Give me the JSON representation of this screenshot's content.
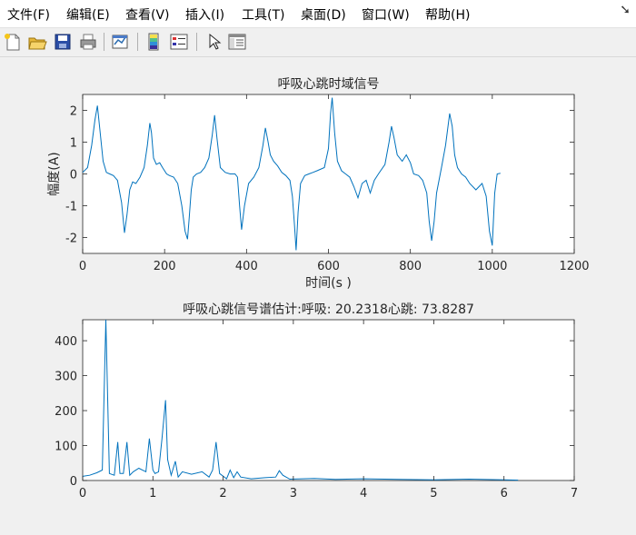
{
  "menubar": {
    "items": [
      "文件(F)",
      "编辑(E)",
      "查看(V)",
      "插入(I)",
      "工具(T)",
      "桌面(D)",
      "窗口(W)",
      "帮助(H)"
    ]
  },
  "toolbar": {
    "icons": [
      "new-figure-icon",
      "open-file-icon",
      "save-icon",
      "print-icon",
      "link-plot-icon",
      "insert-colorbar-icon",
      "insert-legend-icon",
      "edit-plot-icon",
      "property-inspector-icon"
    ]
  },
  "plot1": {
    "title": "呼吸心跳时域信号",
    "xlabel": "时间(s )",
    "ylabel": "幅度(A)",
    "xticks": [
      "0",
      "200",
      "400",
      "600",
      "800",
      "1000",
      "1200"
    ],
    "yticks": [
      "2",
      "1",
      "0",
      "-1",
      "-2"
    ]
  },
  "plot2": {
    "title": "呼吸心跳信号谱估计:呼吸: 20.2318心跳: 73.8287",
    "xticks": [
      "0",
      "1",
      "2",
      "3",
      "4",
      "5",
      "6",
      "7"
    ],
    "yticks": [
      "400",
      "300",
      "200",
      "100",
      "0"
    ]
  },
  "colors": {
    "line": "#0072bd",
    "axes": "#262626",
    "menubar": "#ffffff",
    "window": "#f0f0f0"
  },
  "chart_data": [
    {
      "type": "line",
      "title": "呼吸心跳时域信号",
      "xlabel": "时间(s )",
      "ylabel": "幅度(A)",
      "xlim": [
        0,
        1200
      ],
      "ylim": [
        -2.5,
        2.5
      ],
      "grid": false,
      "series": [
        {
          "x": [
            0,
            12,
            22,
            30,
            36,
            42,
            50,
            58,
            66,
            75,
            85,
            95,
            102,
            108,
            115,
            122,
            130,
            140,
            150,
            158,
            164,
            168,
            173,
            180,
            188,
            195,
            205,
            212,
            222,
            232,
            242,
            250,
            256,
            260,
            265,
            270,
            278,
            288,
            298,
            308,
            316,
            322,
            328,
            336,
            348,
            360,
            372,
            378,
            383,
            388,
            395,
            405,
            418,
            430,
            440,
            446,
            452,
            458,
            466,
            476,
            486,
            496,
            506,
            512,
            517,
            521,
            526,
            532,
            542,
            552,
            562,
            572,
            590,
            600,
            605,
            609,
            615,
            622,
            632,
            642,
            652,
            662,
            672,
            682,
            692,
            702,
            712,
            722,
            738,
            748,
            754,
            760,
            768,
            780,
            790,
            800,
            808,
            820,
            830,
            840,
            846,
            852,
            858,
            864,
            870,
            876,
            886,
            896,
            902,
            908,
            915,
            925,
            935,
            945,
            960,
            975,
            985,
            993,
            1000,
            1006,
            1012,
            1020
          ],
          "y": [
            0.05,
            0.2,
            0.9,
            1.7,
            2.15,
            1.4,
            0.4,
            0.05,
            0.0,
            -0.05,
            -0.2,
            -0.9,
            -1.85,
            -1.3,
            -0.5,
            -0.25,
            -0.3,
            -0.1,
            0.2,
            0.9,
            1.6,
            1.3,
            0.5,
            0.3,
            0.35,
            0.2,
            0.0,
            -0.05,
            -0.1,
            -0.3,
            -1.0,
            -1.8,
            -2.05,
            -1.4,
            -0.5,
            -0.1,
            0.0,
            0.05,
            0.2,
            0.5,
            1.2,
            1.85,
            1.1,
            0.2,
            0.05,
            0.0,
            0.0,
            -0.1,
            -1.0,
            -1.75,
            -1.0,
            -0.3,
            -0.1,
            0.2,
            0.9,
            1.45,
            1.05,
            0.6,
            0.4,
            0.25,
            0.05,
            -0.05,
            -0.2,
            -0.7,
            -1.6,
            -2.4,
            -1.2,
            -0.3,
            -0.05,
            0.0,
            0.05,
            0.1,
            0.2,
            0.8,
            1.9,
            2.4,
            1.3,
            0.4,
            0.1,
            0.0,
            -0.1,
            -0.4,
            -0.75,
            -0.3,
            -0.2,
            -0.6,
            -0.2,
            0.0,
            0.3,
            1.0,
            1.5,
            1.15,
            0.6,
            0.4,
            0.6,
            0.35,
            0.0,
            -0.05,
            -0.2,
            -0.6,
            -1.5,
            -2.1,
            -1.5,
            -0.6,
            -0.2,
            0.2,
            0.9,
            1.9,
            1.5,
            0.6,
            0.2,
            0.0,
            -0.1,
            -0.3,
            -0.5,
            -0.3,
            -0.7,
            -1.8,
            -2.25,
            -0.6,
            0.0,
            0.02
          ]
        }
      ]
    },
    {
      "type": "line",
      "title": "呼吸心跳信号谱估计:呼吸: 20.2318心跳: 73.8287",
      "xlim": [
        0,
        7
      ],
      "ylim": [
        0,
        460
      ],
      "grid": false,
      "series": [
        {
          "x": [
            0,
            0.1,
            0.2,
            0.28,
            0.33,
            0.38,
            0.45,
            0.5,
            0.53,
            0.58,
            0.63,
            0.67,
            0.72,
            0.8,
            0.9,
            0.95,
            1.0,
            1.03,
            1.08,
            1.13,
            1.18,
            1.21,
            1.26,
            1.32,
            1.36,
            1.42,
            1.55,
            1.7,
            1.8,
            1.85,
            1.9,
            1.95,
            2.05,
            2.1,
            2.15,
            2.2,
            2.25,
            2.4,
            2.6,
            2.75,
            2.8,
            2.85,
            2.95,
            3.3,
            3.6,
            4.0,
            4.5,
            5.0,
            5.5,
            6.0,
            6.2
          ],
          "y": [
            12,
            15,
            22,
            30,
            460,
            20,
            15,
            110,
            20,
            20,
            110,
            15,
            25,
            35,
            25,
            120,
            30,
            20,
            25,
            120,
            230,
            60,
            15,
            55,
            10,
            25,
            18,
            25,
            10,
            30,
            110,
            20,
            5,
            30,
            8,
            25,
            10,
            5,
            8,
            10,
            28,
            15,
            4,
            6,
            3,
            5,
            3,
            2,
            4,
            2,
            1
          ]
        }
      ]
    }
  ]
}
